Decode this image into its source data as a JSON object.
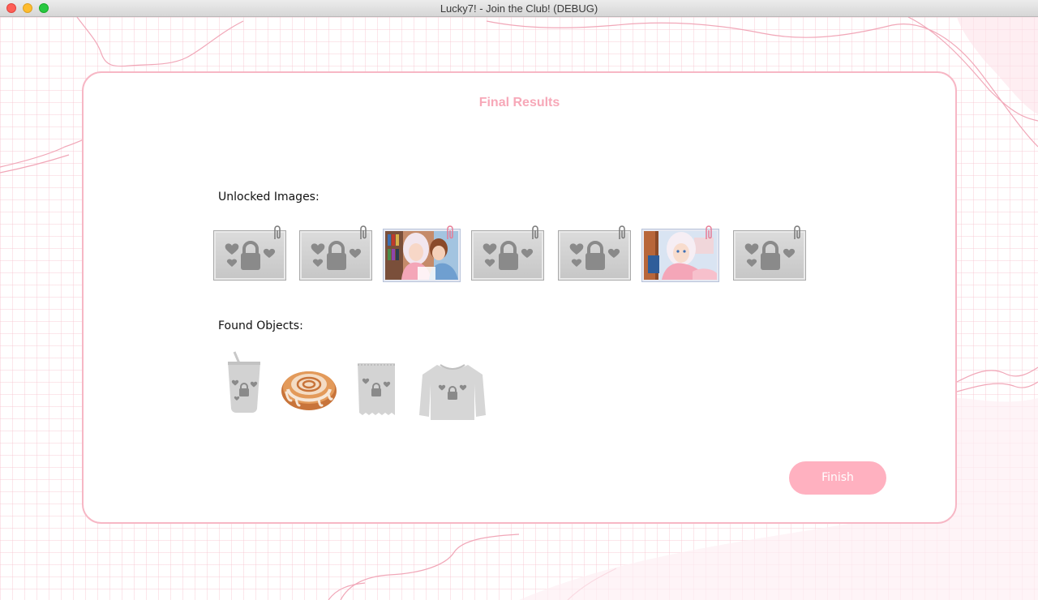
{
  "window": {
    "title": "Lucky7! - Join the Club! (DEBUG)"
  },
  "panel": {
    "title": "Final Results",
    "unlocked_label": "Unlocked Images:",
    "objects_label": "Found Objects:",
    "finish_label": "Finish"
  },
  "gallery": [
    {
      "state": "locked"
    },
    {
      "state": "locked"
    },
    {
      "state": "unlocked"
    },
    {
      "state": "locked"
    },
    {
      "state": "locked"
    },
    {
      "state": "unlocked"
    },
    {
      "state": "locked"
    }
  ],
  "objects": [
    {
      "item": "cup",
      "state": "locked"
    },
    {
      "item": "cinnamon-roll",
      "state": "found"
    },
    {
      "item": "paper-note",
      "state": "locked"
    },
    {
      "item": "sweater",
      "state": "locked"
    }
  ],
  "colors": {
    "accent": "#f7a8b8",
    "button": "#ffb1c0",
    "border": "#f7b7c5",
    "locked_gray": "#8a8a8a"
  }
}
